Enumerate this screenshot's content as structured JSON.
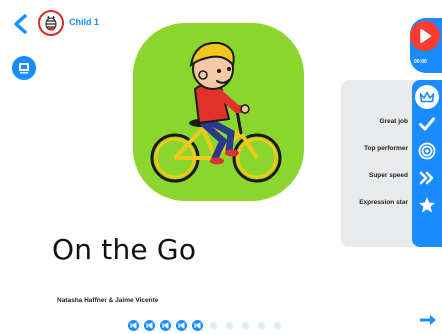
{
  "header": {
    "child_name": "Child 1"
  },
  "book": {
    "title": "On the Go",
    "authors": "Natasha Haffner & Jaime Vicente"
  },
  "player": {
    "time": "00:00"
  },
  "awards": [
    {
      "label": "Great job",
      "icon": "check-icon"
    },
    {
      "label": "Top performer",
      "icon": "target-icon"
    },
    {
      "label": "Super speed",
      "icon": "double-chevron-icon"
    },
    {
      "label": "Expression star",
      "icon": "star-icon"
    }
  ],
  "pages": {
    "total": 10,
    "visited": 5
  },
  "colors": {
    "accent": "#1a8cff",
    "play": "#ff3b2f",
    "illustration_bg": "#8bd62d",
    "panel": "#e9eaec"
  }
}
